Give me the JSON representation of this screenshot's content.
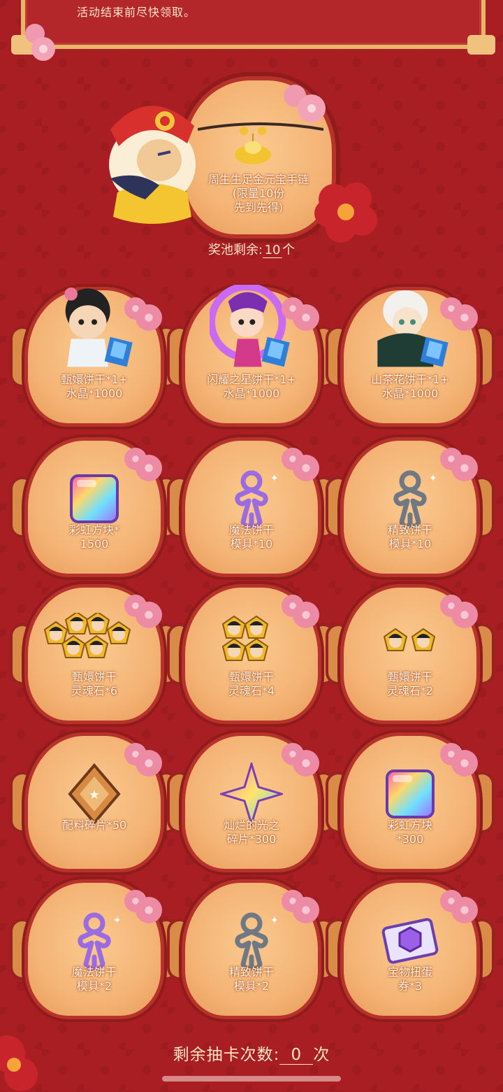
{
  "notice": "活动结束前尽快领取。",
  "grand_prize": {
    "label_line1": "周生生足金元宝手链",
    "label_line2": "(限量10份",
    "label_line3": "先到先得)"
  },
  "pool": {
    "prefix": "奖池剩余:",
    "count": "10",
    "suffix": "个"
  },
  "prizes": [
    {
      "line1": "甄嬛饼干*1+",
      "line2": "水晶*1000",
      "icon": "zhenhuan-cookie-icon"
    },
    {
      "line1": "闪耀之星饼干*1+",
      "line2": "水晶*1000",
      "icon": "shining-star-cookie-icon"
    },
    {
      "line1": "山茶花饼干*1+",
      "line2": "水晶*1000",
      "icon": "camellia-cookie-icon"
    },
    {
      "line1": "彩虹方块*",
      "line2": "1500",
      "icon": "rainbow-cube-icon"
    },
    {
      "line1": "魔法饼干",
      "line2": "模具*10",
      "icon": "magic-cookie-cutter-icon"
    },
    {
      "line1": "精致饼干",
      "line2": "模具*10",
      "icon": "fine-cookie-cutter-icon"
    },
    {
      "line1": "甄嬛饼干",
      "line2": "灵魂石*6",
      "icon": "soulstone-icon"
    },
    {
      "line1": "甄嬛饼干",
      "line2": "灵魂石*4",
      "icon": "soulstone-icon"
    },
    {
      "line1": "甄嬛饼干",
      "line2": "灵魂石*2",
      "icon": "soulstone-icon"
    },
    {
      "line1": "配料碎片*50",
      "line2": "",
      "icon": "topping-shard-icon"
    },
    {
      "line1": "灿烂的光之",
      "line2": "碎片*300",
      "icon": "radiant-shard-icon"
    },
    {
      "line1": "彩虹方块",
      "line2": "*300",
      "icon": "rainbow-cube-icon"
    },
    {
      "line1": "魔法饼干",
      "line2": "模具*2",
      "icon": "magic-cookie-cutter-icon"
    },
    {
      "line1": "精致饼干",
      "line2": "模具*2",
      "icon": "fine-cookie-cutter-icon"
    },
    {
      "line1": "宝物扭蛋",
      "line2": "券*3",
      "icon": "treasure-ticket-icon"
    }
  ],
  "draws": {
    "prefix": "剩余抽卡次数:",
    "count": "0",
    "suffix": "次"
  },
  "colors": {
    "background": "#a81e22",
    "plate": "#f4b476",
    "label": "#fff3e6"
  }
}
